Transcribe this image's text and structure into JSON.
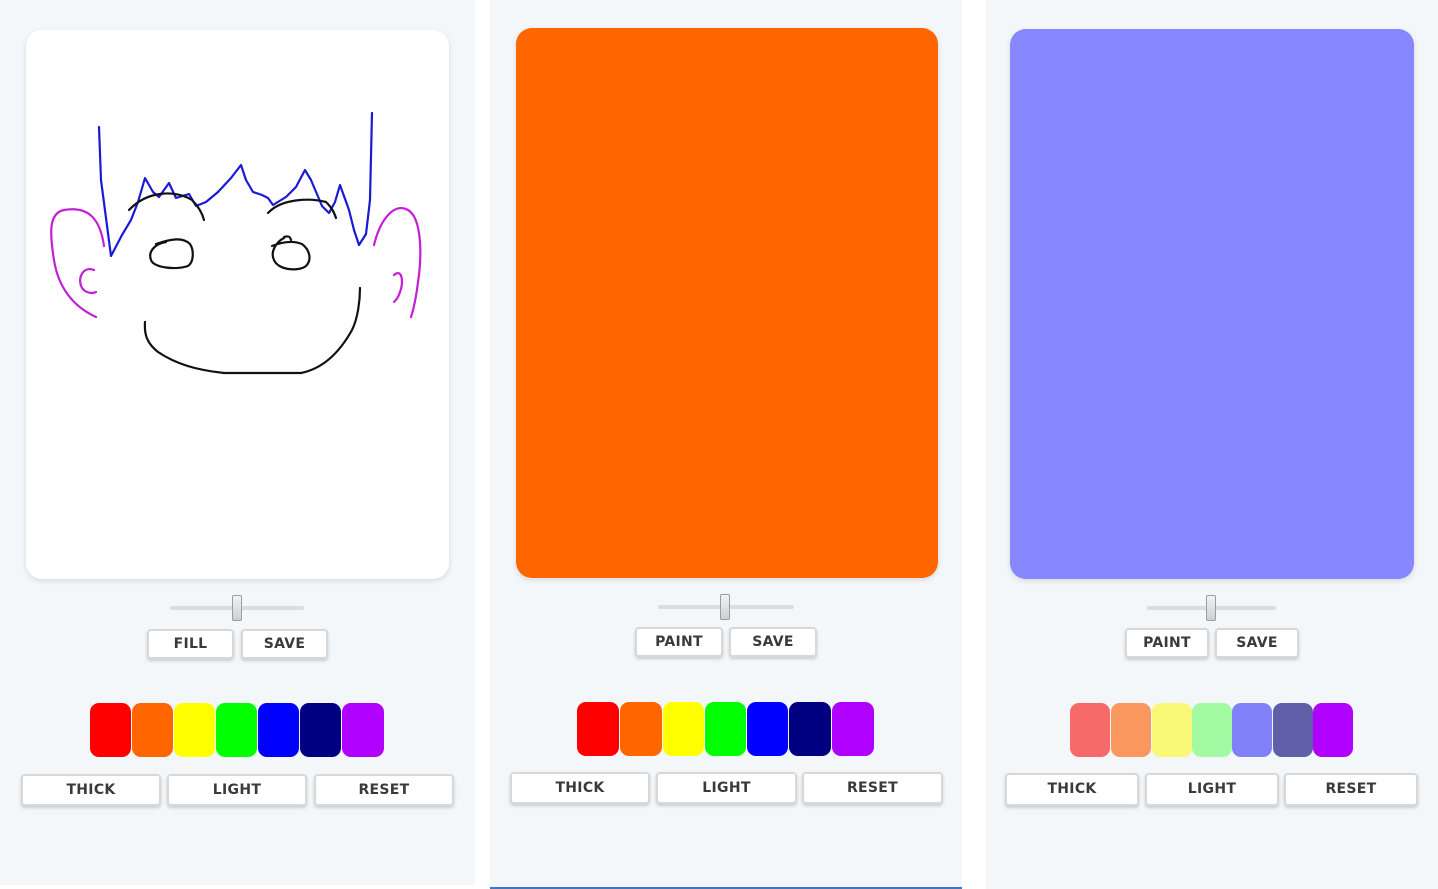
{
  "panels": [
    {
      "canvas_color": "#ffffff",
      "mode_button": "FILL",
      "save_button": "SAVE",
      "slider_value": 0.5,
      "palette": [
        "#ff0000",
        "#ff6600",
        "#ffff00",
        "#00ff00",
        "#0000ff",
        "#000080",
        "#b000ff"
      ],
      "bottom_buttons": [
        "THICK",
        "LIGHT",
        "RESET"
      ]
    },
    {
      "canvas_color": "#ff6600",
      "mode_button": "PAINT",
      "save_button": "SAVE",
      "slider_value": 0.5,
      "palette": [
        "#ff0000",
        "#ff6600",
        "#ffff00",
        "#00ff00",
        "#0000ff",
        "#000080",
        "#b000ff"
      ],
      "bottom_buttons": [
        "THICK",
        "LIGHT",
        "RESET"
      ]
    },
    {
      "canvas_color": "#8787ff",
      "mode_button": "PAINT",
      "save_button": "SAVE",
      "slider_value": 0.5,
      "palette": [
        "#f76a6a",
        "#fa9860",
        "#f8f876",
        "#a2fba2",
        "#8080f8",
        "#6060a8",
        "#b000ff"
      ],
      "bottom_buttons": [
        "THICK",
        "LIGHT",
        "RESET"
      ]
    }
  ],
  "drawing_colors": {
    "hair": "#1a1ad6",
    "ears": "#c21fd6",
    "face": "#111111"
  }
}
